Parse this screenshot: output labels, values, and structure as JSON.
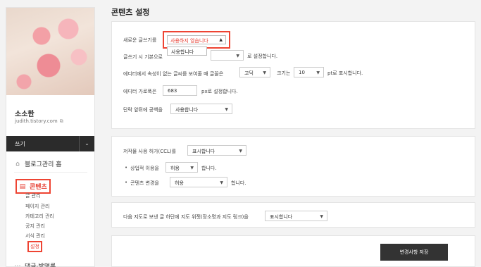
{
  "sidebar": {
    "blog_name": "소소한",
    "blog_url": "judith.tistory.com",
    "write_label": "쓰기",
    "nav": {
      "home": "블로그관리 홈",
      "contents": "콘텐츠",
      "sub_items": [
        "글 관리",
        "페이지 관리",
        "카테고리 관리",
        "공지 관리",
        "서식 관리",
        "설정"
      ],
      "comments": "댓글·방명록"
    },
    "icons": {
      "home": "home-icon",
      "contents": "document-icon",
      "comments": "comment-icon",
      "external": "external-link-icon",
      "toggle": "chevron-down-icon"
    }
  },
  "page": {
    "title": "콘텐츠 설정"
  },
  "settings": {
    "new_write": {
      "label": "새로운 글쓰기를",
      "value": "사용하지 않습니다",
      "dropdown_option": "사용합니다"
    },
    "default_write": {
      "label": "글쓰기 시 기본으로",
      "value": "",
      "suffix": "로 설정합니다."
    },
    "attributes": {
      "label": "에디터에서 속성이 없는 글씨를 보여줄 때 글꼴은",
      "font_value": "고딕",
      "size_label": "크기는",
      "size_value": "10",
      "suffix": "pt로 표시합니다."
    },
    "editor_width": {
      "label": "에디터 가로폭은",
      "value": "683",
      "suffix": "px로 설정합니다."
    },
    "paragraph_space": {
      "label": "단락 앞뒤에 공백을",
      "value": "사용합니다"
    },
    "ccl": {
      "label": "저작물 사용 허가(CCL)를",
      "value": "표시합니다"
    },
    "commercial": {
      "label": "상업적 이용을",
      "value": "허용",
      "suffix": "합니다."
    },
    "modify": {
      "label": "콘텐츠 변경을",
      "value": "허용",
      "suffix": "합니다."
    },
    "map": {
      "label": "다음 지도로 보낸 글 하단에 지도 위젯(장소명과 지도 링크)을",
      "value": "표시합니다"
    }
  },
  "actions": {
    "save": "변경사항 저장"
  },
  "colors": {
    "highlight": "#e43333",
    "accent_text": "#e63a2e",
    "dark_bar": "#2b2b2b",
    "save_button": "#333333"
  }
}
